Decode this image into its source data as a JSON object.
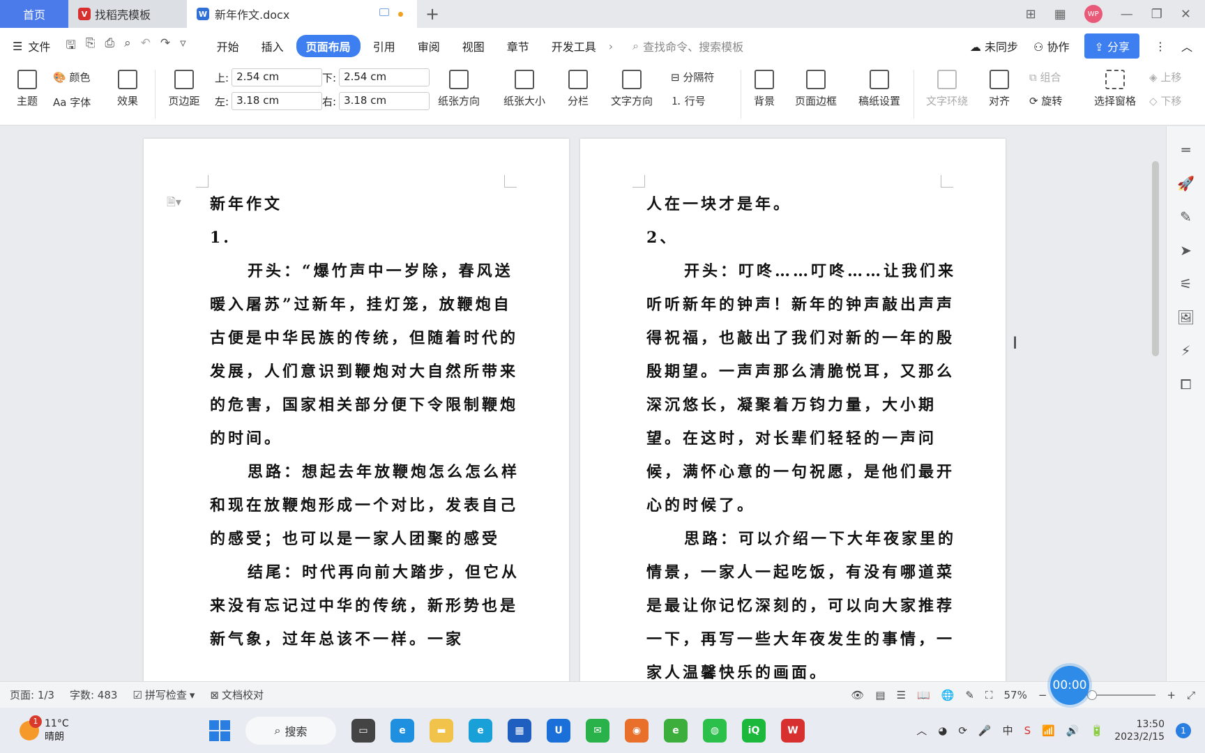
{
  "tabs": {
    "home": "首页",
    "template": "找稻壳模板",
    "document": "新年作文.docx",
    "avatar": "WP"
  },
  "menu": {
    "file": "文件",
    "tabs": [
      "开始",
      "插入",
      "页面布局",
      "引用",
      "审阅",
      "视图",
      "章节",
      "开发工具"
    ],
    "active_tab": "页面布局",
    "search_placeholder": "查找命令、搜索模板",
    "sync": "未同步",
    "collab": "协作",
    "share": "分享"
  },
  "ribbon": {
    "theme": "主题",
    "color": "颜色",
    "font": "字体",
    "effect": "效果",
    "margin": "页边距",
    "top_label": "上:",
    "top_value": "2.54 cm",
    "bottom_label": "下:",
    "bottom_value": "2.54 cm",
    "left_label": "左:",
    "left_value": "3.18 cm",
    "right_label": "右:",
    "right_value": "3.18 cm",
    "orientation": "纸张方向",
    "size": "纸张大小",
    "columns": "分栏",
    "text_direction": "文字方向",
    "breaks": "分隔符",
    "line_numbers": "行号",
    "background": "背景",
    "page_border": "页面边框",
    "grid_paper": "稿纸设置",
    "text_wrap": "文字环绕",
    "align": "对齐",
    "group": "组合",
    "rotate": "旋转",
    "selection_pane": "选择窗格",
    "bring_forward": "上移",
    "send_backward": "下移"
  },
  "page1": {
    "title": "新年作文",
    "num": "1.",
    "p1": "开头：“爆竹声中一岁除，春风送暖入屠苏”过新年，挂灯笼，放鞭炮自古便是中华民族的传统，但随着时代的发展，人们意识到鞭炮对大自然所带来的危害，国家相关部分便下令限制鞭炮的时间。",
    "p2": "思路：想起去年放鞭炮怎么怎么样和现在放鞭炮形成一个对比，发表自己的感受；也可以是一家人团聚的感受",
    "p3": "结尾：时代再向前大踏步，但它从来没有忘记过中华的传统，新形势也是新气象，过年总该不一样。一家"
  },
  "page2": {
    "line1": "人在一块才是年。",
    "num": "2、",
    "p1": "开头：叮咚……叮咚……让我们来听听新年的钟声！新年的钟声敲出声声得祝福，也敲出了我们对新的一年的殷殷期望。一声声那么清脆悦耳，又那么深沉悠长，凝聚着万钧力量，大小期望。在这时，对长辈们轻轻的一声问候，满怀心意的一句祝愿，是他们最开心的时候了。",
    "p2": "思路：可以介绍一下大年夜家里的情景，一家人一起吃饭，有没有哪道菜是最让你记忆深刻的，可以向大家推荐一下，再写一些大年夜发生的事情，一家人温馨快乐的画面。"
  },
  "status": {
    "page": "页面: 1/3",
    "words": "字数: 483",
    "spell": "拼写检查",
    "proof": "文档校对",
    "zoom": "57%",
    "zoom_fraction": 0.57,
    "timer": "00:00"
  },
  "taskbar": {
    "temp": "11°C",
    "weather": "晴朗",
    "weather_badge": "1",
    "search": "搜索",
    "time": "13:50",
    "date": "2023/2/15",
    "notif": "1",
    "ime": "中"
  },
  "colors": {
    "accent": "#3d7ff0",
    "home_tab": "#4b7bea"
  }
}
